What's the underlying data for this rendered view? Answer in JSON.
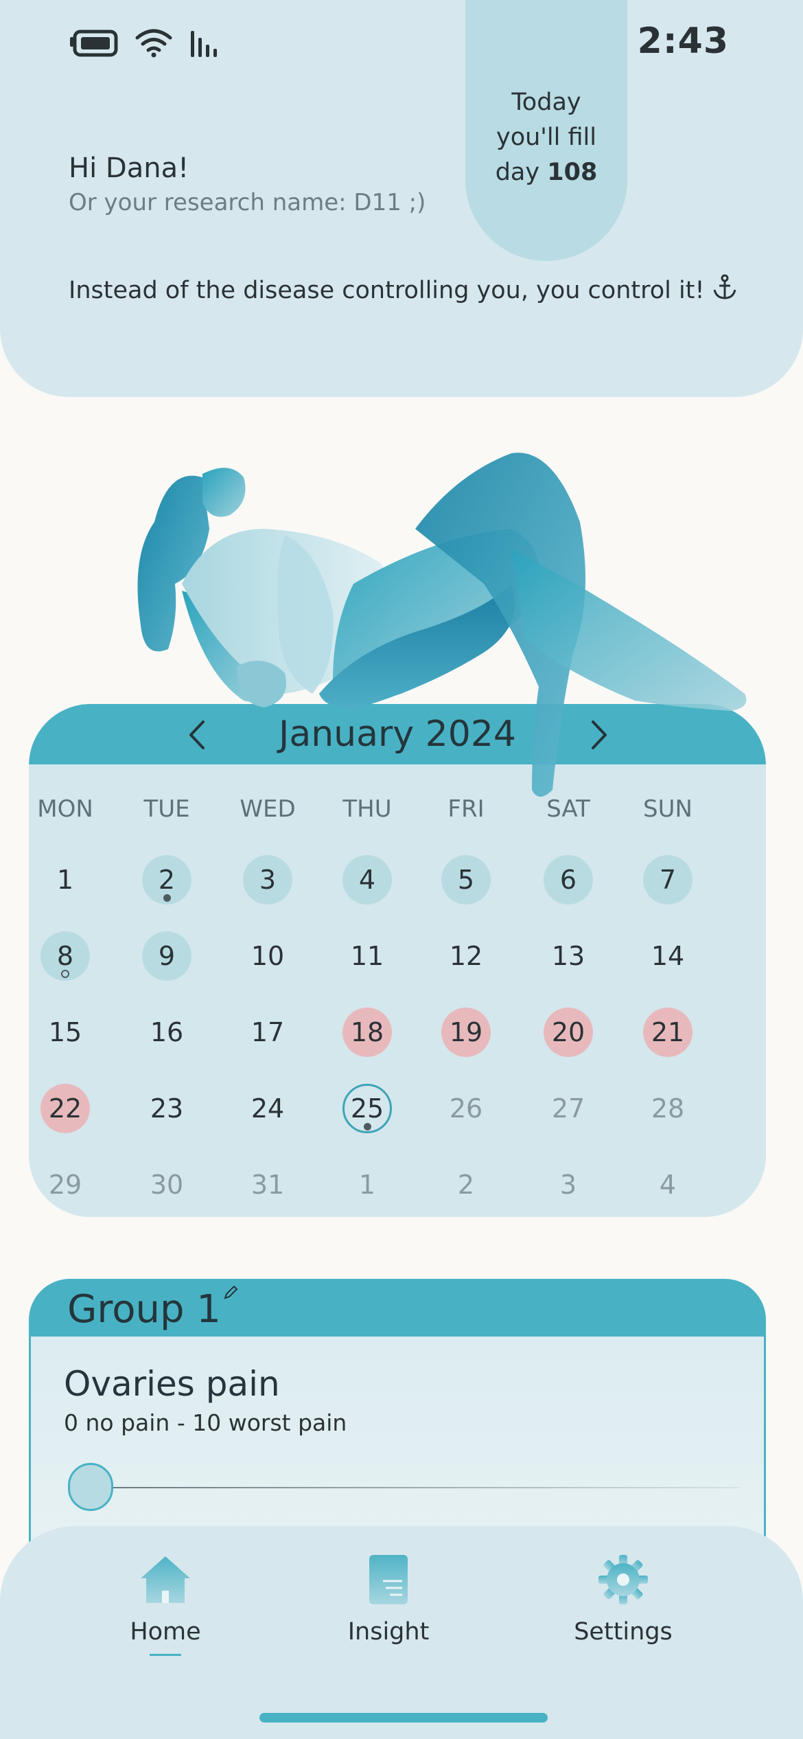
{
  "status_bar": {
    "time": "2:43",
    "icons": [
      "battery-icon",
      "wifi-icon",
      "signal-icon"
    ]
  },
  "header": {
    "greeting": "Hi Dana!",
    "research_name": "Or your research name: D11 ;)",
    "motto": "Instead of the disease controlling you, you control it!",
    "motto_icon": "anchor-icon",
    "day_pill": {
      "line1": "Today",
      "line2": "you'll fill",
      "line3_prefix": "day",
      "day_number": "108"
    }
  },
  "illustration": {
    "name": "reclining-woman-illustration"
  },
  "calendar": {
    "month_label": "January 2024",
    "weekdays": [
      "MON",
      "TUE",
      "WED",
      "THU",
      "FRI",
      "SAT",
      "SUN"
    ],
    "weeks": [
      [
        {
          "d": "1",
          "s": ""
        },
        {
          "d": "2",
          "s": "past",
          "dot": "filled"
        },
        {
          "d": "3",
          "s": "past"
        },
        {
          "d": "4",
          "s": "past"
        },
        {
          "d": "5",
          "s": "past"
        },
        {
          "d": "6",
          "s": "past"
        },
        {
          "d": "7",
          "s": "past"
        }
      ],
      [
        {
          "d": "8",
          "s": "past",
          "dot": "hollow"
        },
        {
          "d": "9",
          "s": "past"
        },
        {
          "d": "10",
          "s": ""
        },
        {
          "d": "11",
          "s": ""
        },
        {
          "d": "12",
          "s": ""
        },
        {
          "d": "13",
          "s": ""
        },
        {
          "d": "14",
          "s": ""
        }
      ],
      [
        {
          "d": "15",
          "s": ""
        },
        {
          "d": "16",
          "s": ""
        },
        {
          "d": "17",
          "s": ""
        },
        {
          "d": "18",
          "s": "period"
        },
        {
          "d": "19",
          "s": "period"
        },
        {
          "d": "20",
          "s": "period"
        },
        {
          "d": "21",
          "s": "period"
        }
      ],
      [
        {
          "d": "22",
          "s": "period"
        },
        {
          "d": "23",
          "s": ""
        },
        {
          "d": "24",
          "s": ""
        },
        {
          "d": "25",
          "s": "today",
          "dot": "filled"
        },
        {
          "d": "26",
          "s": "muted"
        },
        {
          "d": "27",
          "s": "muted"
        },
        {
          "d": "28",
          "s": "muted"
        }
      ],
      [
        {
          "d": "29",
          "s": "muted"
        },
        {
          "d": "30",
          "s": "muted"
        },
        {
          "d": "31",
          "s": "muted"
        },
        {
          "d": "1",
          "s": "muted"
        },
        {
          "d": "2",
          "s": "muted"
        },
        {
          "d": "3",
          "s": "muted"
        },
        {
          "d": "4",
          "s": "muted"
        }
      ]
    ]
  },
  "group": {
    "title": "Group 1",
    "question_title": "Ovaries pain",
    "question_scale": "0 no pain - 10 worst pain",
    "slider_value": 0
  },
  "nav": {
    "items": [
      {
        "label": "Home",
        "icon": "home-icon",
        "active": true
      },
      {
        "label": "Insight",
        "icon": "insight-icon",
        "active": false
      },
      {
        "label": "Settings",
        "icon": "gear-icon",
        "active": false
      }
    ]
  },
  "colors": {
    "accent": "#48b2c4",
    "header_bg": "#d6e8ed",
    "period": "#e8b9bc",
    "past_day": "#b8dbe2"
  }
}
